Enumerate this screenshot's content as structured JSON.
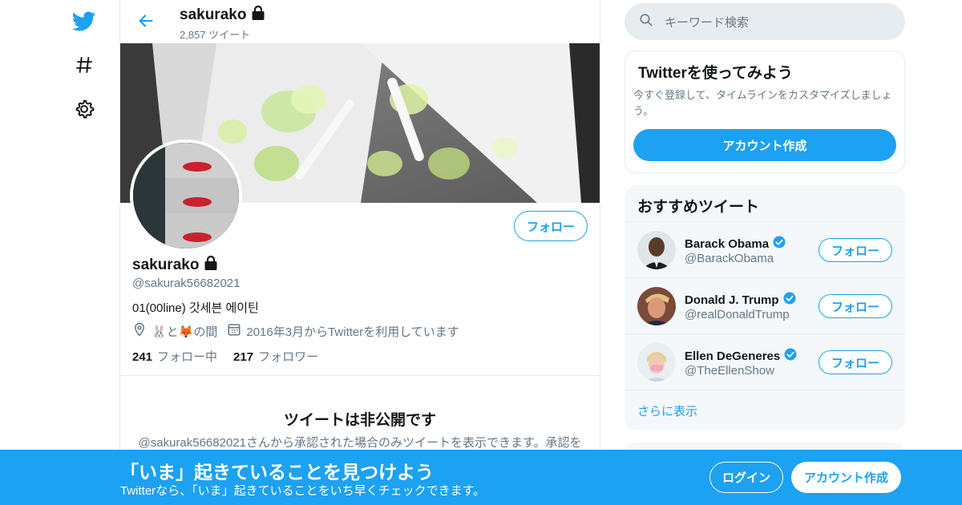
{
  "colors": {
    "accent": "#1da1f2",
    "text_primary": "#14171a",
    "text_secondary": "#657786",
    "border": "#e6ecf0",
    "panel_bg": "#f5f8fa"
  },
  "nav": {
    "icons": [
      "twitter-bird-icon",
      "hashtag-icon",
      "gear-icon"
    ]
  },
  "header": {
    "name": "sakurako",
    "tweet_count": "2,857 ツイート"
  },
  "profile": {
    "follow_label": "フォロー",
    "name": "sakurako",
    "handle": "@sakurak56682021",
    "bio": "01(00line) 갓세븐 에이틴",
    "location": "🐰と🦊の間",
    "joined": "2016年3月からTwitterを利用しています",
    "following_count": "241",
    "following_label": "フォロー中",
    "followers_count": "217",
    "followers_label": "フォロワー"
  },
  "protected": {
    "title": "ツイートは非公開です",
    "description": "@sakurak56682021さんから承認された場合のみツイートを表示できます。承認を"
  },
  "search": {
    "placeholder": "キーワード検索"
  },
  "signup_card": {
    "title": "Twitterを使ってみよう",
    "description": "今すぐ登録して、タイムラインをカスタマイズしましょう。",
    "button": "アカウント作成"
  },
  "recommended": {
    "title": "おすすめツイート",
    "users": [
      {
        "name": "Barack Obama",
        "handle": "@BarackObama",
        "follow": "フォロー"
      },
      {
        "name": "Donald J. Trump",
        "handle": "@realDonaldTrump",
        "follow": "フォロー"
      },
      {
        "name": "Ellen DeGeneres",
        "handle": "@TheEllenShow",
        "follow": "フォロー"
      }
    ],
    "more_label": "さらに表示"
  },
  "bottom_bar": {
    "title": "「いま」起きていることを見つけよう",
    "subtitle": "Twitterなら、「いま」起きていることをいち早くチェックできます。",
    "login": "ログイン",
    "signup": "アカウント作成"
  }
}
